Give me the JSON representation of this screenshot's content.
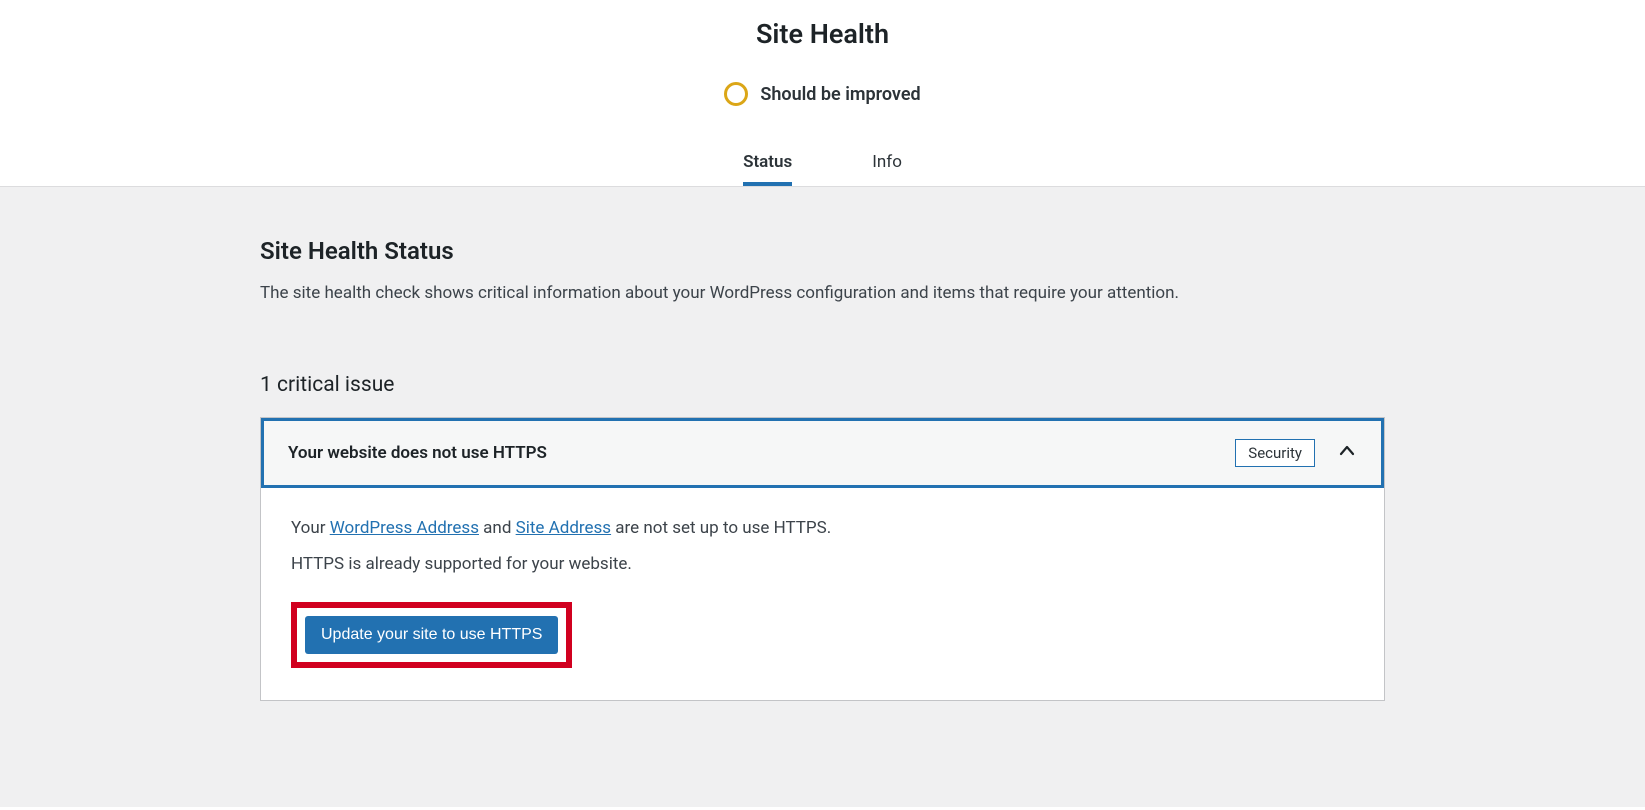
{
  "header": {
    "title": "Site Health",
    "status_label": "Should be improved",
    "tabs": [
      {
        "label": "Status",
        "active": true
      },
      {
        "label": "Info",
        "active": false
      }
    ]
  },
  "main": {
    "section_title": "Site Health Status",
    "section_desc": "The site health check shows critical information about your WordPress configuration and items that require your attention.",
    "issues_heading": "1 critical issue",
    "issue": {
      "title": "Your website does not use HTTPS",
      "badge": "Security",
      "line1_prefix": "Your ",
      "link1": "WordPress Address",
      "line1_mid": " and ",
      "link2": "Site Address",
      "line1_suffix": " are not set up to use HTTPS.",
      "line2": "HTTPS is already supported for your website.",
      "button": "Update your site to use HTTPS"
    }
  },
  "colors": {
    "accent": "#2271b1",
    "warning_ring": "#dba617",
    "highlight_border": "#d1001f"
  }
}
